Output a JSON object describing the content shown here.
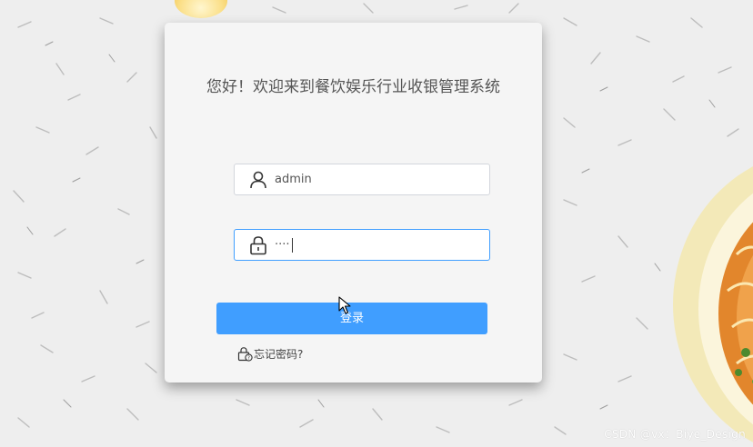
{
  "login_card": {
    "title": "您好！欢迎来到餐饮娱乐行业收银管理系统",
    "username": {
      "icon": "user-icon",
      "value": "admin"
    },
    "password": {
      "icon": "lock-icon",
      "masked_value": "····",
      "focused": true
    },
    "login_button_label": "登录",
    "forgot_password_label": "忘记密码?",
    "forgot_password_icon": "lock-question-icon"
  },
  "watermark": "CSDN @vx：Biye_Design",
  "colors": {
    "primary_button": "#409eff",
    "focused_border": "#409eff",
    "card_background": "#f5f5f5",
    "page_background": "#eeeeee"
  }
}
